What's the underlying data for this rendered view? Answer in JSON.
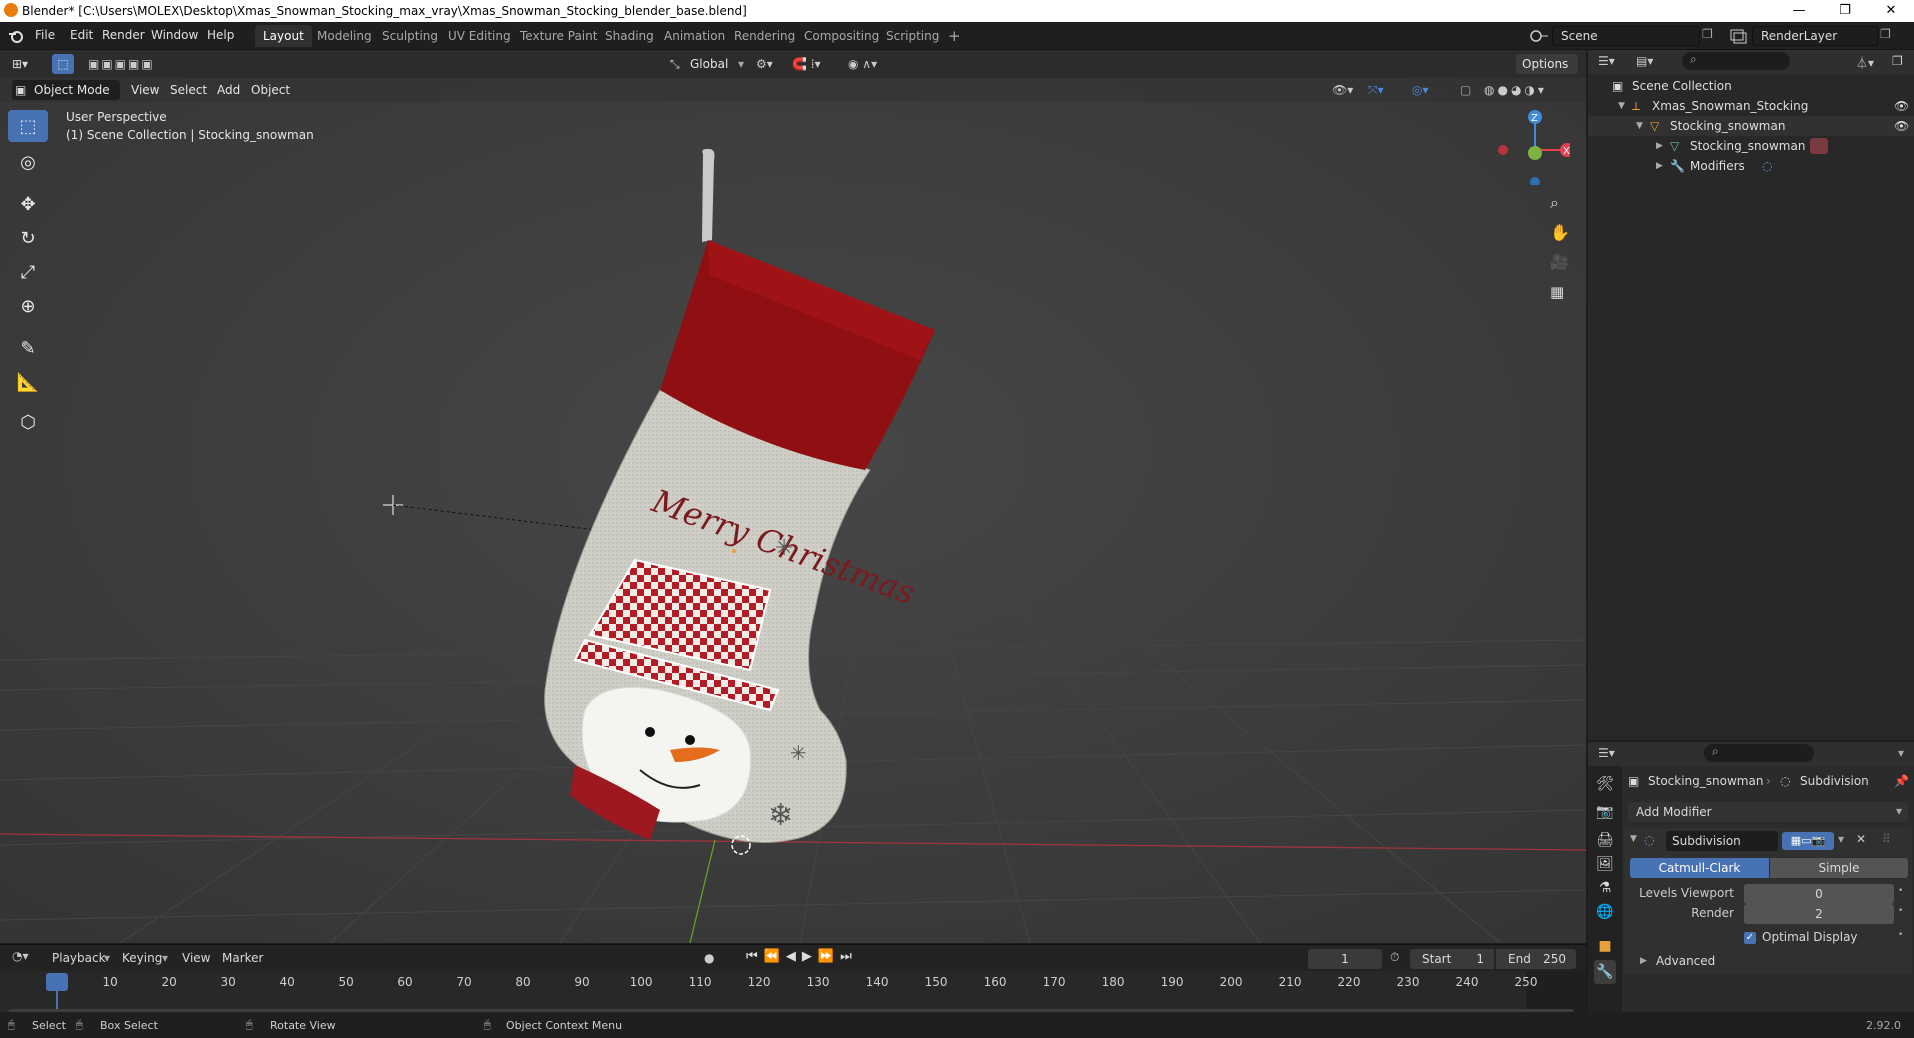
{
  "window": {
    "title": "Blender* [C:\\Users\\MOLEX\\Desktop\\Xmas_Snowman_Stocking_max_vray\\Xmas_Snowman_Stocking_blender_base.blend]",
    "minimize": "—",
    "maximize": "❐",
    "close": "✕"
  },
  "menu": [
    "File",
    "Edit",
    "Render",
    "Window",
    "Help"
  ],
  "workspaces": [
    "Layout",
    "Modeling",
    "Sculpting",
    "UV Editing",
    "Texture Paint",
    "Shading",
    "Animation",
    "Rendering",
    "Compositing",
    "Scripting"
  ],
  "workspace_add": "+",
  "scene": {
    "name": "Scene",
    "render_layer": "RenderLayer"
  },
  "viewport": {
    "mode": "Object Mode",
    "header_menus": [
      "View",
      "Select",
      "Add",
      "Object"
    ],
    "transform_orientation": "Global",
    "options": "Options",
    "overlay_line1": "User Perspective",
    "overlay_line2": "(1) Scene Collection | Stocking_snowman",
    "gizmo_x": "X",
    "gizmo_y": "Y",
    "gizmo_z": "Z",
    "stocking_text": "Merry Christmas"
  },
  "outliner": {
    "root": "Scene Collection",
    "items": [
      {
        "label": "Xmas_Snowman_Stocking"
      },
      {
        "label": "Stocking_snowman"
      },
      {
        "label": "Stocking_snowman"
      },
      {
        "label": "Modifiers"
      }
    ]
  },
  "properties": {
    "object_name": "Stocking_snowman",
    "modifier_tab": "Subdivision",
    "add_modifier": "Add Modifier",
    "modifier_name": "Subdivision",
    "mode_active": "Catmull-Clark",
    "mode_other": "Simple",
    "levels_viewport_label": "Levels Viewport",
    "levels_viewport_value": "0",
    "render_label": "Render",
    "render_value": "2",
    "optimal_display": "Optimal Display",
    "advanced": "Advanced"
  },
  "timeline": {
    "menus": [
      "Playback",
      "Keying",
      "View",
      "Marker"
    ],
    "current_frame": "1",
    "start_label": "Start",
    "start_value": "1",
    "end_label": "End",
    "end_value": "250",
    "ticks": [
      "1",
      "10",
      "20",
      "30",
      "40",
      "50",
      "60",
      "70",
      "80",
      "90",
      "100",
      "110",
      "120",
      "130",
      "140",
      "150",
      "160",
      "170",
      "180",
      "190",
      "200",
      "210",
      "220",
      "230",
      "240",
      "250"
    ]
  },
  "statusbar": {
    "select": "Select",
    "box_select": "Box Select",
    "rotate_view": "Rotate View",
    "context_menu": "Object Context Menu",
    "version": "2.92.0"
  },
  "colors": {
    "accent": "#4772b3",
    "stocking_red": "#8f0f12",
    "stocking_body": "#cfcfc7",
    "x_axis": "#e8414d",
    "y_axis": "#7cb342",
    "z_axis": "#3d8bd9"
  }
}
